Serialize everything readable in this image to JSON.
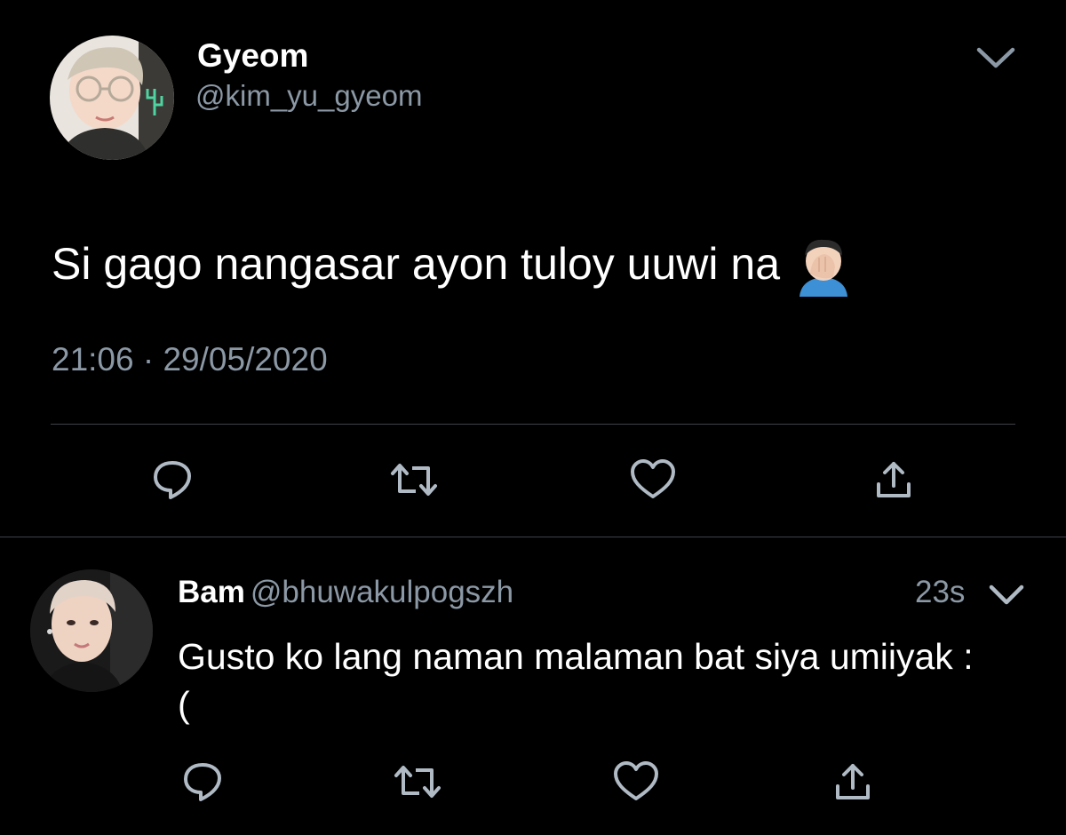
{
  "tweet": {
    "author_name": "Gyeom",
    "author_handle": "@kim_yu_gyeom",
    "text": "Si gago nangasar ayon tuloy uuwi na",
    "emoji": "man-facepalming",
    "time": "21:06",
    "separator": "·",
    "date": "29/05/2020",
    "menu_icon": "chevron-down-icon"
  },
  "actions": {
    "reply_icon": "reply-icon",
    "retweet_icon": "retweet-icon",
    "like_icon": "heart-icon",
    "share_icon": "share-icon"
  },
  "reply": {
    "author_name": "Bam",
    "author_handle": "@bhuwakulpogszh",
    "time_ago": "23s",
    "text": "Gusto ko lang naman malaman bat siya umiiyak :("
  },
  "colors": {
    "background": "#000000",
    "text": "#ffffff",
    "secondary_text": "#8b98a5",
    "divider": "#3d4147"
  }
}
